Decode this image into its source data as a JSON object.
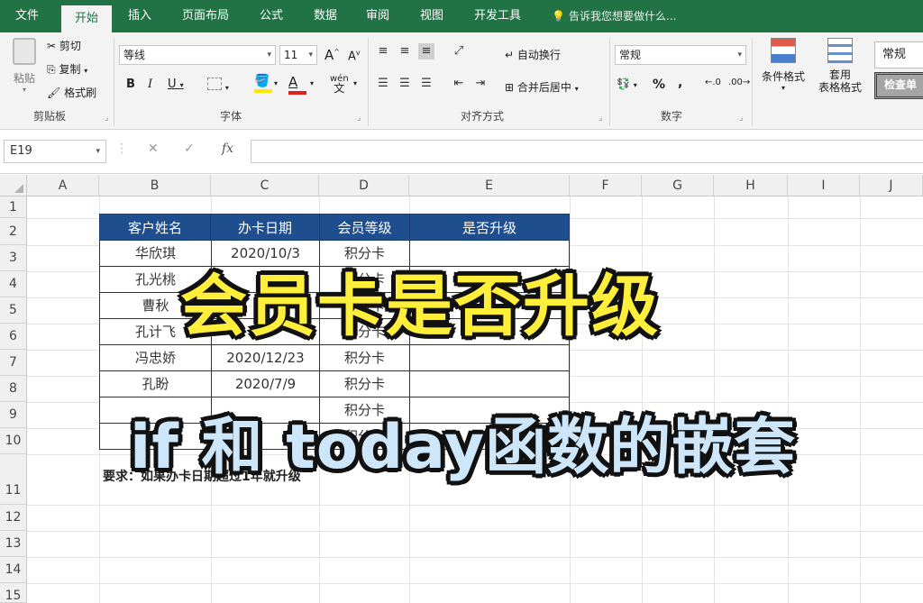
{
  "tabs": [
    "文件",
    "开始",
    "插入",
    "页面布局",
    "公式",
    "数据",
    "审阅",
    "视图",
    "开发工具"
  ],
  "active_tab": "开始",
  "tell_me": "告诉我您想要做什么...",
  "ribbon": {
    "clipboard": {
      "paste": "粘贴",
      "cut": "剪切",
      "copy": "复制",
      "format_painter": "格式刷",
      "label": "剪贴板"
    },
    "font": {
      "name": "等线",
      "size": "11",
      "grow": "A",
      "shrink": "A",
      "bold": "B",
      "italic": "I",
      "underline": "U",
      "border_icon": "border-icon",
      "fill_icon": "fill-color-icon",
      "font_color_icon": "font-color-icon",
      "font_color": "#e0201a",
      "fill_color": "#ffe600",
      "phonetic": "wén",
      "label": "字体"
    },
    "alignment": {
      "wrap": "自动换行",
      "merge": "合并后居中",
      "label": "对齐方式"
    },
    "number": {
      "format": "常规",
      "percent": "%",
      "comma": ",",
      "label": "数字"
    },
    "styles": {
      "conditional": "条件格式",
      "table_format_1": "套用",
      "table_format_2": "表格格式",
      "style_normal": "常规",
      "style_check": "检查单"
    }
  },
  "formula_bar": {
    "cell_ref": "E19",
    "cancel": "✕",
    "enter": "✓",
    "fx": "fx",
    "content": ""
  },
  "columns": [
    "A",
    "B",
    "C",
    "D",
    "E",
    "F",
    "G",
    "H",
    "I",
    "J"
  ],
  "rows": [
    "1",
    "2",
    "3",
    "4",
    "5",
    "6",
    "7",
    "8",
    "9",
    "10",
    "11",
    "12",
    "13",
    "14",
    "15"
  ],
  "table": {
    "headers": [
      "客户姓名",
      "办卡日期",
      "会员等级",
      "是否升级"
    ],
    "header_color": "#1f4e8f",
    "rows": [
      [
        "华欣琪",
        "2020/10/3",
        "积分卡",
        ""
      ],
      [
        "孔光桃",
        "",
        "积分卡",
        ""
      ],
      [
        "曹秋",
        "",
        "积分卡",
        ""
      ],
      [
        "孔计飞",
        "",
        "积分卡",
        ""
      ],
      [
        "冯忠娇",
        "2020/12/23",
        "积分卡",
        ""
      ],
      [
        "孔盼",
        "2020/7/9",
        "积分卡",
        ""
      ],
      [
        "",
        "",
        "积分卡",
        ""
      ],
      [
        "",
        "",
        "积分卡",
        ""
      ]
    ]
  },
  "note": "要求：如果办卡日期超过1年就升级",
  "overlay": {
    "title": "会员卡是否升级",
    "subtitle": "if 和 today函数的嵌套",
    "title_color": "#ffef3a",
    "subtitle_color": "#cde6fa"
  }
}
